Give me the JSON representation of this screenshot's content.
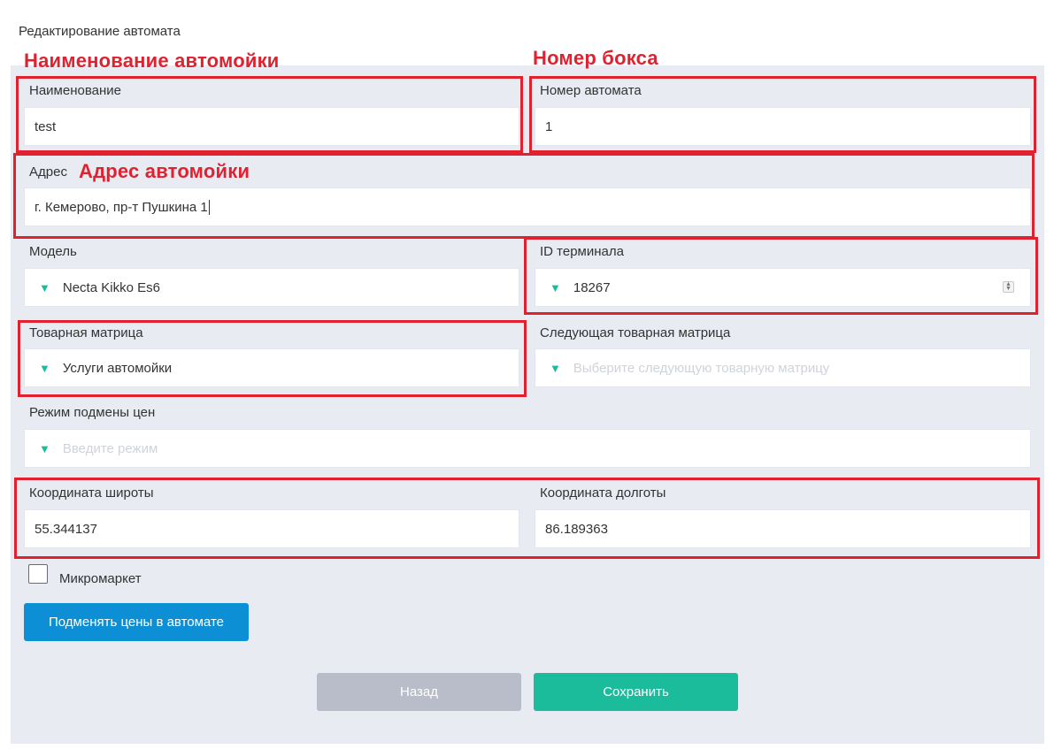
{
  "page": {
    "title": "Редактирование автомата"
  },
  "form": {
    "name": {
      "label": "Наименование",
      "value": "test"
    },
    "machine_number": {
      "label": "Номер автомата",
      "value": "1"
    },
    "address": {
      "label": "Адрес",
      "value": "г. Кемерово, пр-т Пушкина 1"
    },
    "model": {
      "label": "Модель",
      "value": "Necta Kikko Es6"
    },
    "terminal_id": {
      "label": "ID терминала",
      "value": "18267"
    },
    "product_matrix": {
      "label": "Товарная матрица",
      "value": "Услуги автомойки"
    },
    "next_product_matrix": {
      "label": "Следующая товарная матрица",
      "placeholder": "Выберите следующую товарную матрицу"
    },
    "price_mode": {
      "label": "Режим подмены цен",
      "placeholder": "Введите режим"
    },
    "latitude": {
      "label": "Координата широты",
      "value": "55.344137"
    },
    "longitude": {
      "label": "Координата долготы",
      "value": "86.189363"
    },
    "micromarket": {
      "label": "Микромаркет",
      "checked": false
    }
  },
  "buttons": {
    "replace_prices": "Подменять цены в автомате",
    "back": "Назад",
    "save": "Сохранить"
  },
  "annotations": {
    "carwash_name": "Наименование автомойки",
    "box_number": "Номер бокса",
    "carwash_address": "Адрес автомойки"
  },
  "icons": {
    "dropdown": "caret-down-icon",
    "spinner": "number-spinner-icon"
  },
  "colors": {
    "panel_bg": "#e9ebf3",
    "accent_green": "#1bbc9b",
    "primary_blue": "#0d8fd6",
    "back_gray": "#b8bdc9",
    "annotation_red": "#e02230"
  }
}
